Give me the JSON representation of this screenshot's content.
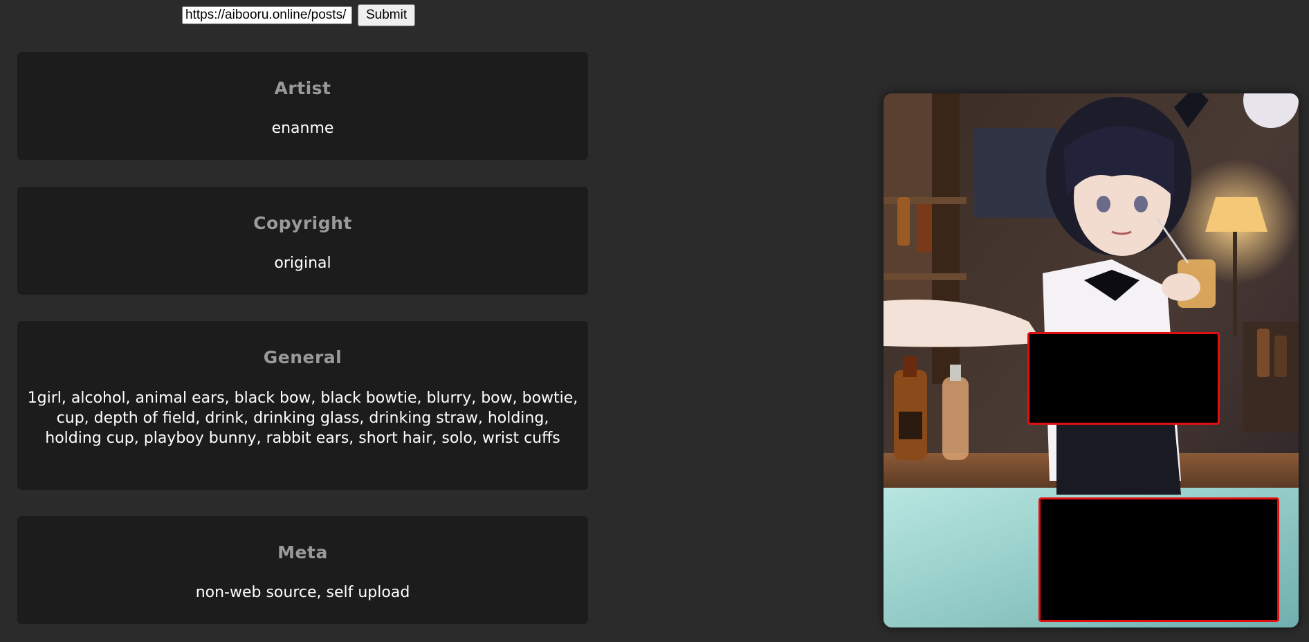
{
  "form": {
    "url_value": "https://aibooru.online/posts/",
    "submit_label": "Submit"
  },
  "tags": {
    "artist": {
      "title": "Artist",
      "value": "enanme"
    },
    "copyright": {
      "title": "Copyright",
      "value": "original"
    },
    "general": {
      "title": "General",
      "value": "1girl, alcohol, animal ears, black bow, black bowtie, blurry, bow, bowtie, cup, depth of field, drink, drinking glass, drinking straw, holding, holding cup, playboy bunny, rabbit ears, short hair, solo, wrist cuffs"
    },
    "meta": {
      "title": "Meta",
      "value": "non-web source, self upload"
    }
  },
  "colors": {
    "page_background": "#2b2b2b",
    "card_background": "#1c1c1c",
    "card_title": "#9a9a9a",
    "card_value": "#ffffff",
    "censor_border": "#e01010"
  }
}
